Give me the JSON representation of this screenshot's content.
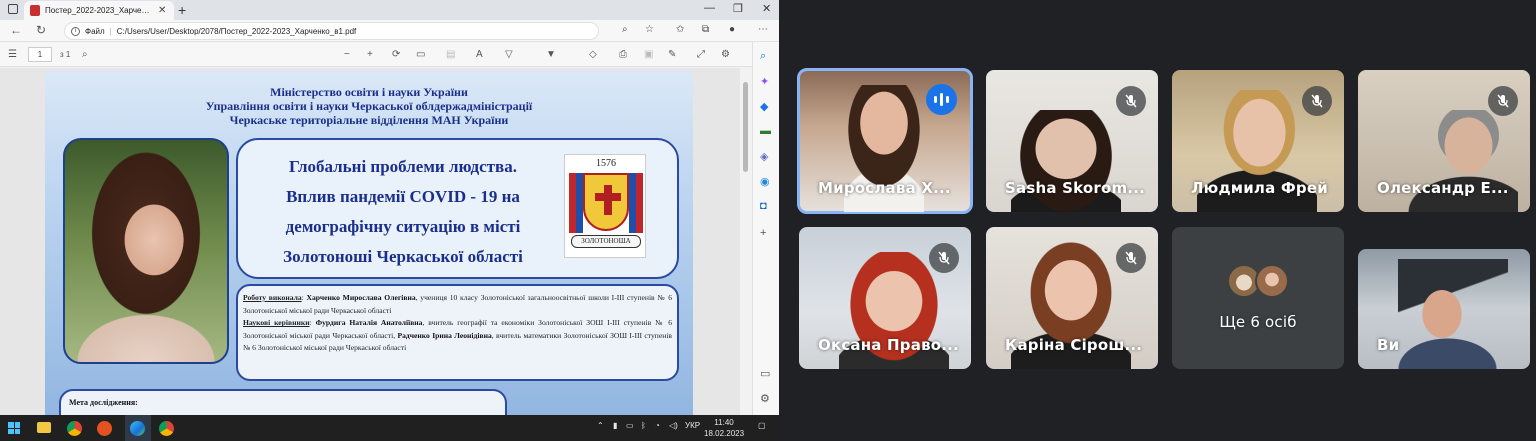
{
  "browser": {
    "tab_title": "Постер_2022-2023_Харченко_в",
    "address_prefix": "Файл",
    "address_url": "C:/Users/User/Desktop/2078/Постер_2022-2023_Харченко_в1.pdf"
  },
  "pdf_toolbar": {
    "page_current": "1",
    "page_total": "з 1"
  },
  "poster": {
    "header_lines": [
      "Міністерство освіти і науки України",
      "Управління освіти і науки Черкаської облдержадміністрації",
      "Черкаське територіальне відділення МАН України"
    ],
    "title_lines": [
      "Глобальні проблеми людства.",
      "Вплив пандемії COVID - 19 на",
      "демографічну ситуацію в місті",
      "Золотоноші Черкаської області"
    ],
    "coat_year": "1576",
    "coat_ribbon": "ЗОЛОТОНОША",
    "author_label": "Роботу виконала",
    "author_name": "Харченко Мирослава Олегівна",
    "author_rest": ", учениця 10 класу Золотоніської загальноосвітньої школи І-ІІІ ступенів № 6 Золотоніської міської ради Черкаської області",
    "advisors_label": "Наукові керівники",
    "advisor1_name": "Фурдига Наталія Анатоліївна",
    "advisor1_rest": ", вчитель географії та економіки Золотоніської ЗОШ І-ІІІ ступенів № 6 Золотоніської міської ради Черкаської області, ",
    "advisor2_name": "Радченко Ірина Леонідівна",
    "advisor2_rest": ", вчитель математики Золотоніської ЗОШ І-ІІІ ступенів № 6 Золотоніської міської ради Черкаської області",
    "goal_label": "Мета дослідження:"
  },
  "meet": {
    "tiles": [
      {
        "name": "Мирослава Х...",
        "state": "speaking"
      },
      {
        "name": "Sasha Skorom...",
        "state": "muted"
      },
      {
        "name": "Людмила Фрей",
        "state": "muted"
      },
      {
        "name": "Олександр Е...",
        "state": "muted"
      },
      {
        "name": "Оксана Право...",
        "state": "muted"
      },
      {
        "name": "Каріна Сірош...",
        "state": "muted"
      },
      {
        "name": "Ще 6 осіб",
        "state": "overflow"
      },
      {
        "name": "Ви",
        "state": "self"
      }
    ]
  },
  "taskbar": {
    "language": "УКР",
    "time": "11:40",
    "date": "18.02.2023"
  }
}
